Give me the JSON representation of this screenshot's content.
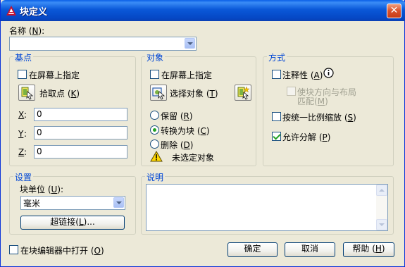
{
  "window": {
    "title": "块定义",
    "close_symbol": "✕"
  },
  "name": {
    "label": "名称",
    "hotkey": "N",
    "value": ""
  },
  "base_point": {
    "title": "基点",
    "specify_on_screen": "在屏幕上指定",
    "pick_point_label": "拾取点",
    "pick_point_hotkey": "K",
    "x_label": "X",
    "y_label": "Y",
    "z_label": "Z",
    "x": "0",
    "y": "0",
    "z": "0"
  },
  "objects": {
    "title": "对象",
    "specify_on_screen": "在屏幕上指定",
    "select_objects_label": "选择对象",
    "select_objects_hotkey": "T",
    "retain_label": "保留",
    "retain_hotkey": "R",
    "convert_label": "转换为块",
    "convert_hotkey": "C",
    "delete_label": "删除",
    "delete_hotkey": "D",
    "warning_text": "未选定对象"
  },
  "behavior": {
    "title": "方式",
    "annotative_label": "注释性",
    "annotative_hotkey": "A",
    "match_orientation_line1": "使块方向与布局",
    "match_orientation_line2": "匹配",
    "match_orientation_hotkey": "M",
    "scale_uniform_label": "按统一比例缩放",
    "scale_uniform_hotkey": "S",
    "allow_explode_label": "允许分解",
    "allow_explode_hotkey": "P",
    "allow_explode_checked": true
  },
  "settings": {
    "title": "设置",
    "block_unit_label": "块单位",
    "block_unit_hotkey": "U",
    "block_unit_value": "毫米",
    "hyperlink_label": "超链接",
    "hyperlink_hotkey": "L",
    "hyperlink_suffix": "..."
  },
  "description": {
    "title": "说明",
    "value": ""
  },
  "footer": {
    "open_in_editor": "在块编辑器中打开",
    "open_in_editor_hotkey": "O",
    "ok": "确定",
    "cancel": "取消",
    "help": "帮助",
    "help_hotkey": "H"
  },
  "colors": {
    "group_title": "#0046d5",
    "titlebar": "#0a58d8"
  }
}
